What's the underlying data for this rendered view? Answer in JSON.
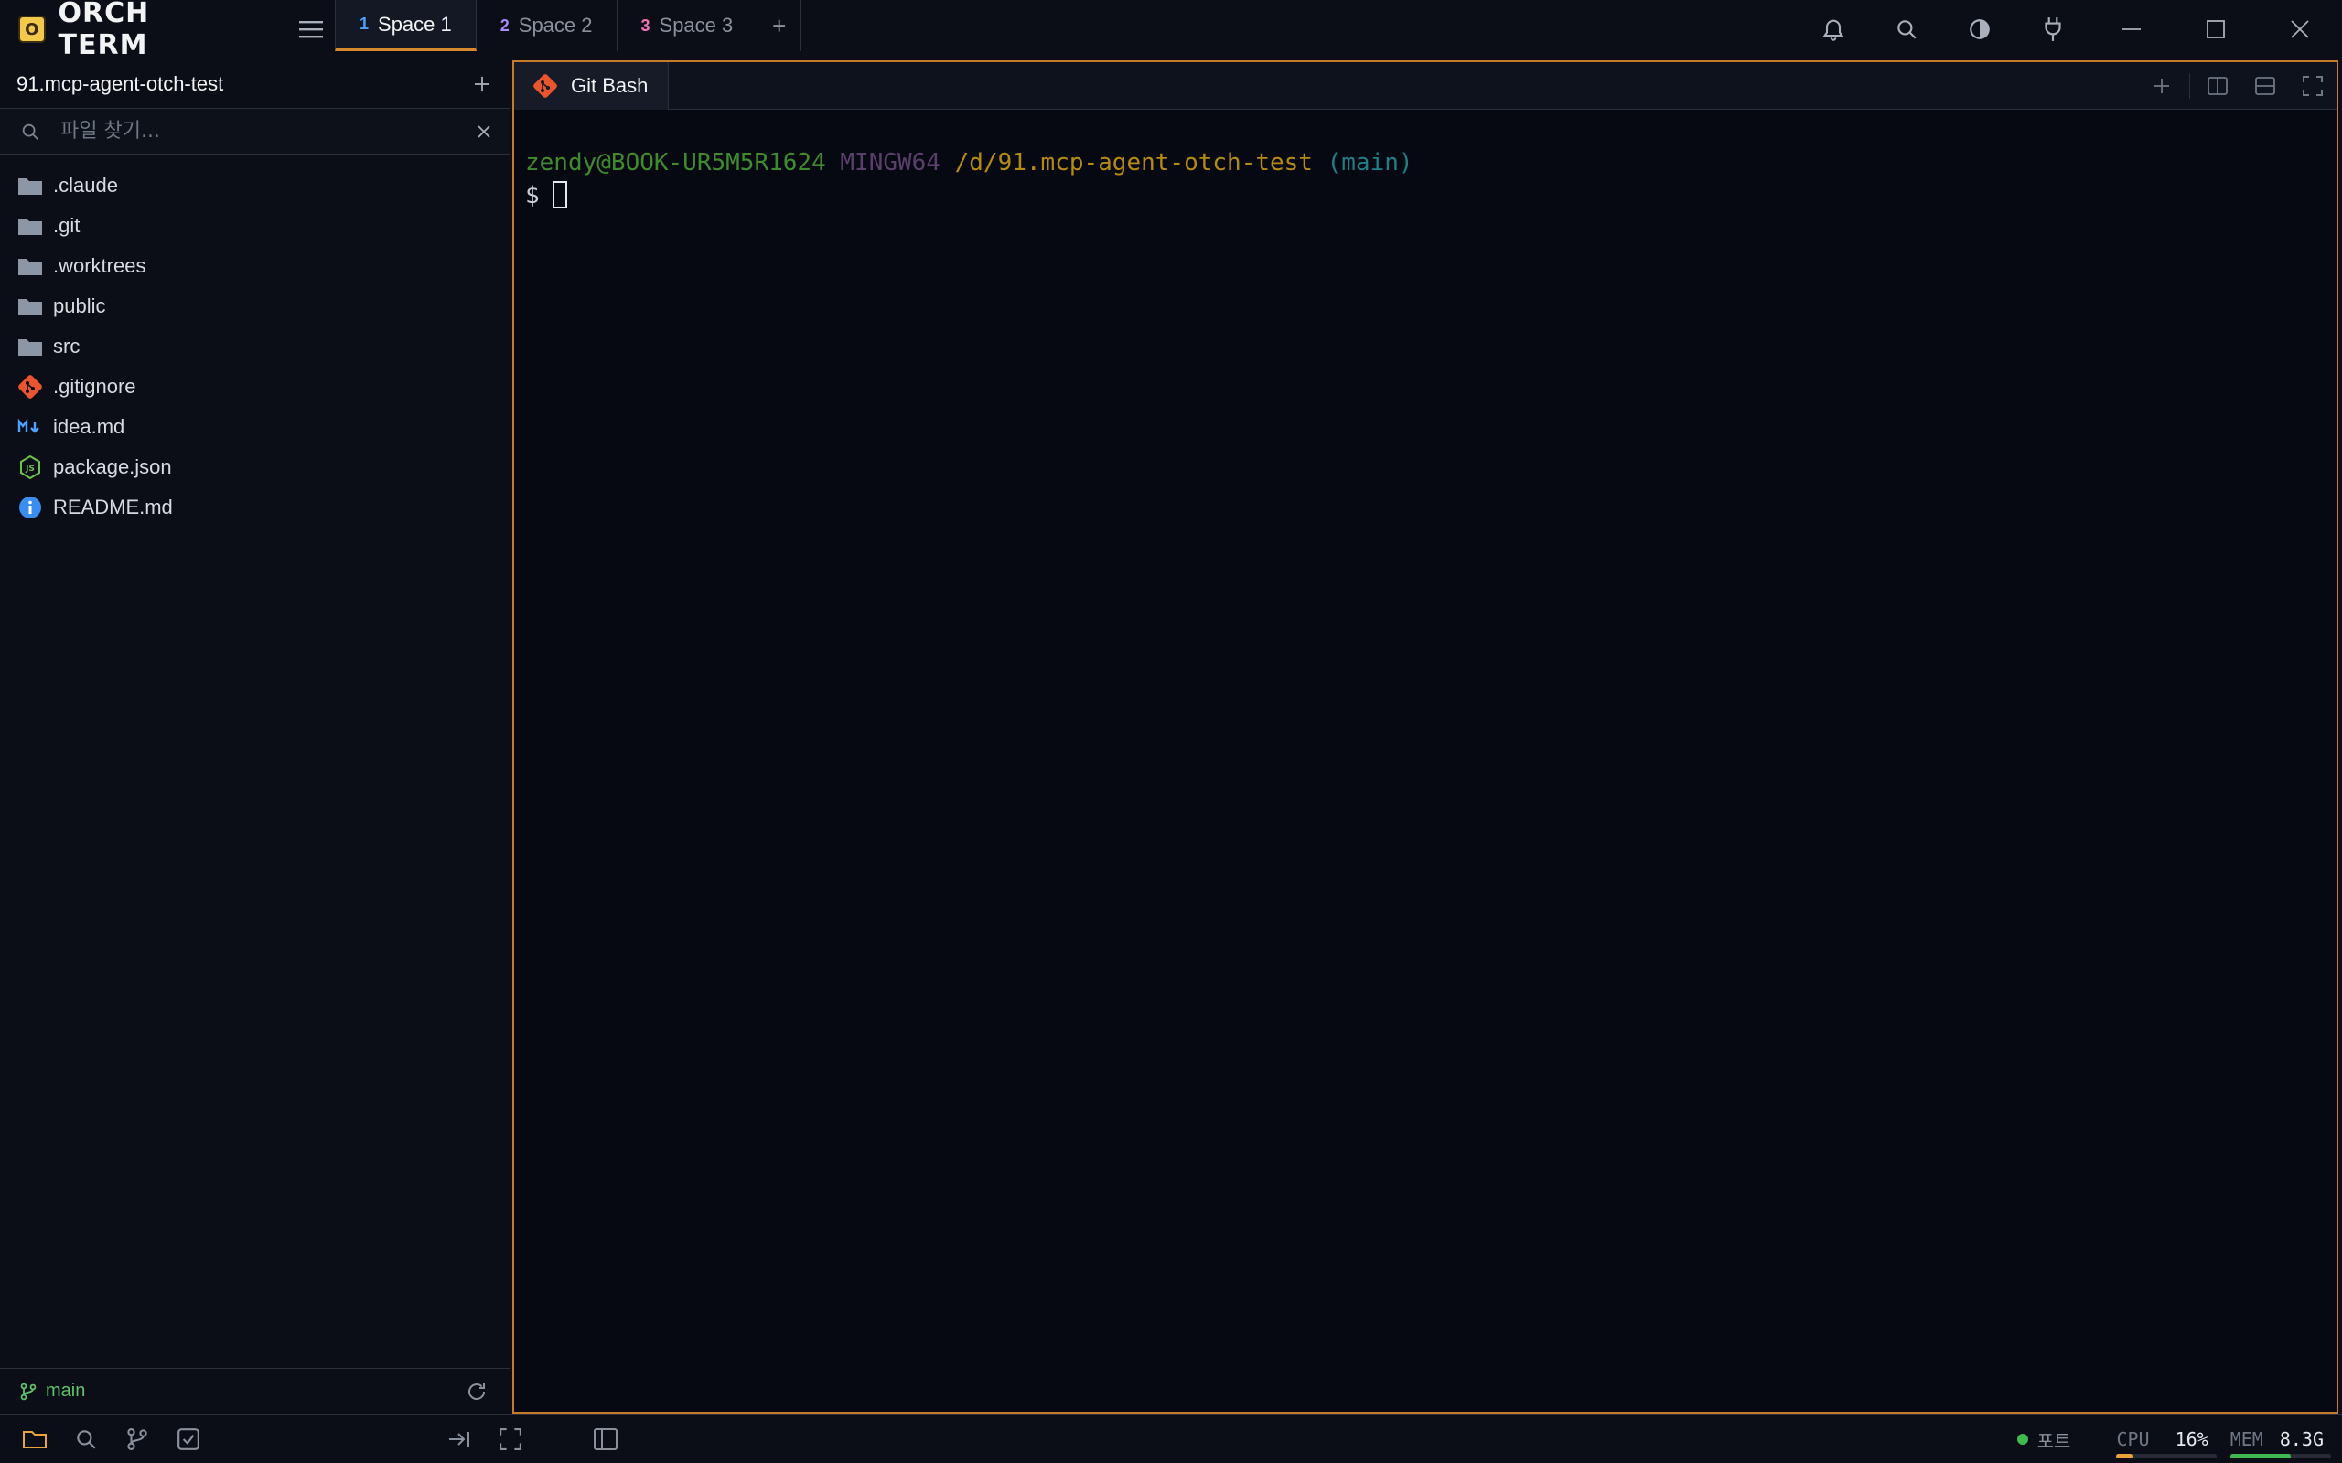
{
  "app": {
    "name": "ORCH TERM",
    "logo_letter": "O"
  },
  "tabs": [
    {
      "num": "1",
      "label": "Space 1",
      "color": "#4ea1ff",
      "active": true
    },
    {
      "num": "2",
      "label": "Space 2",
      "color": "#a78bfa",
      "active": false
    },
    {
      "num": "3",
      "label": "Space 3",
      "color": "#f472b6",
      "active": false
    }
  ],
  "tab_add": "+",
  "sidebar": {
    "title": "91.mcp-agent-otch-test",
    "add": "+",
    "search_placeholder": "파일 찾기...",
    "items": [
      {
        "label": ".claude",
        "icon": "folder-icon"
      },
      {
        "label": ".git",
        "icon": "folder-icon"
      },
      {
        "label": ".worktrees",
        "icon": "folder-icon"
      },
      {
        "label": "public",
        "icon": "folder-icon"
      },
      {
        "label": "src",
        "icon": "folder-icon"
      },
      {
        "label": ".gitignore",
        "icon": "git-file-icon"
      },
      {
        "label": "idea.md",
        "icon": "markdown-icon"
      },
      {
        "label": "package.json",
        "icon": "nodejs-icon"
      },
      {
        "label": "README.md",
        "icon": "info-icon"
      }
    ],
    "branch": "main"
  },
  "terminal": {
    "tab_label": "Git Bash",
    "prompt_user": "zendy@BOOK-UR5M5R1624",
    "prompt_system": "MINGW64",
    "prompt_path": "/d/91.mcp-agent-otch-test",
    "prompt_branch": "(main)",
    "prompt_symbol": "$"
  },
  "status": {
    "port_label": "포트",
    "cpu_label": "CPU",
    "cpu_value": "16%",
    "cpu_fraction": 0.16,
    "mem_label": "MEM",
    "mem_value": "8.3G",
    "mem_fraction": 0.6
  },
  "colors": {
    "accent": "#d88a2c",
    "branch": "#5cc26a",
    "folder": "#8d96a5",
    "port_dot": "#3fb950",
    "cpu_bar": "#e8a33c",
    "mem_bar": "#3fb950"
  }
}
